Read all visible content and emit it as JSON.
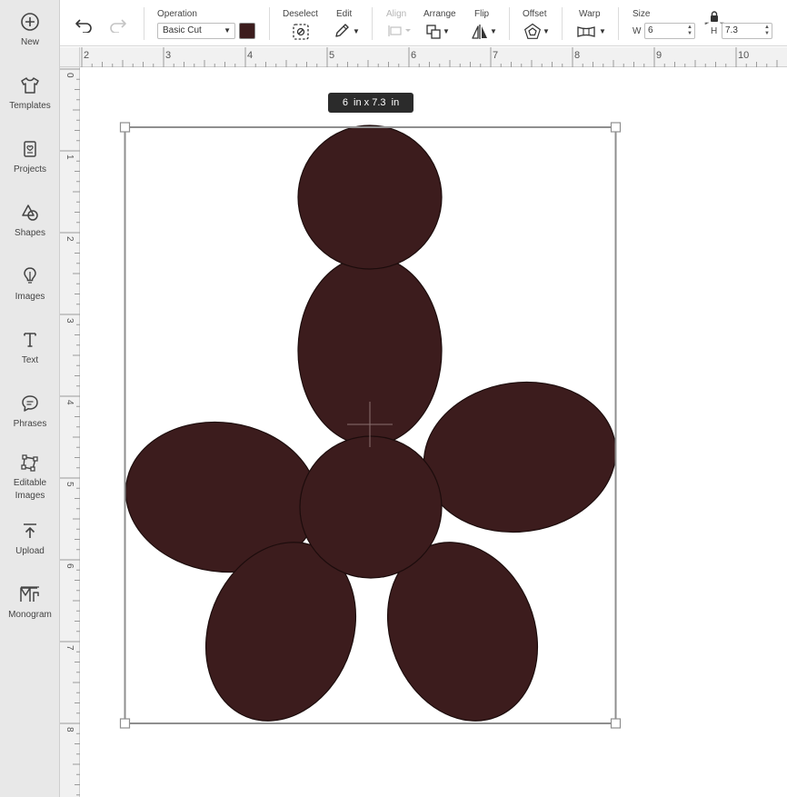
{
  "sidebar": {
    "items": [
      {
        "label": "New",
        "icon": "plus-circle-icon"
      },
      {
        "label": "Templates",
        "icon": "tshirt-icon"
      },
      {
        "label": "Projects",
        "icon": "project-icon"
      },
      {
        "label": "Shapes",
        "icon": "shapes-icon"
      },
      {
        "label": "Images",
        "icon": "lightbulb-icon"
      },
      {
        "label": "Text",
        "icon": "text-icon"
      },
      {
        "label": "Phrases",
        "icon": "speech-bubble-icon"
      },
      {
        "label": "Editable\nImages",
        "icon": "editable-images-icon"
      },
      {
        "label": "Upload",
        "icon": "upload-icon"
      },
      {
        "label": "Monogram",
        "icon": "monogram-icon"
      }
    ]
  },
  "toolbar": {
    "operation_label": "Operation",
    "operation_value": "Basic Cut",
    "operation_color": "#3c1c1d",
    "deselect_label": "Deselect",
    "edit_label": "Edit",
    "align_label": "Align",
    "arrange_label": "Arrange",
    "flip_label": "Flip",
    "offset_label": "Offset",
    "warp_label": "Warp",
    "size_label": "Size",
    "width_label": "W",
    "width_value": "6",
    "height_label": "H",
    "height_value": "7.3"
  },
  "rulers": {
    "top_numbers": [
      "2",
      "3",
      "4",
      "5",
      "6",
      "7",
      "8",
      "9",
      "10"
    ],
    "left_numbers": [
      "0",
      "1",
      "2",
      "3",
      "4",
      "5",
      "6",
      "7",
      "8"
    ]
  },
  "canvas": {
    "size_tooltip": "6  in x 7.3  in",
    "shape_color": "#3c1c1d"
  }
}
